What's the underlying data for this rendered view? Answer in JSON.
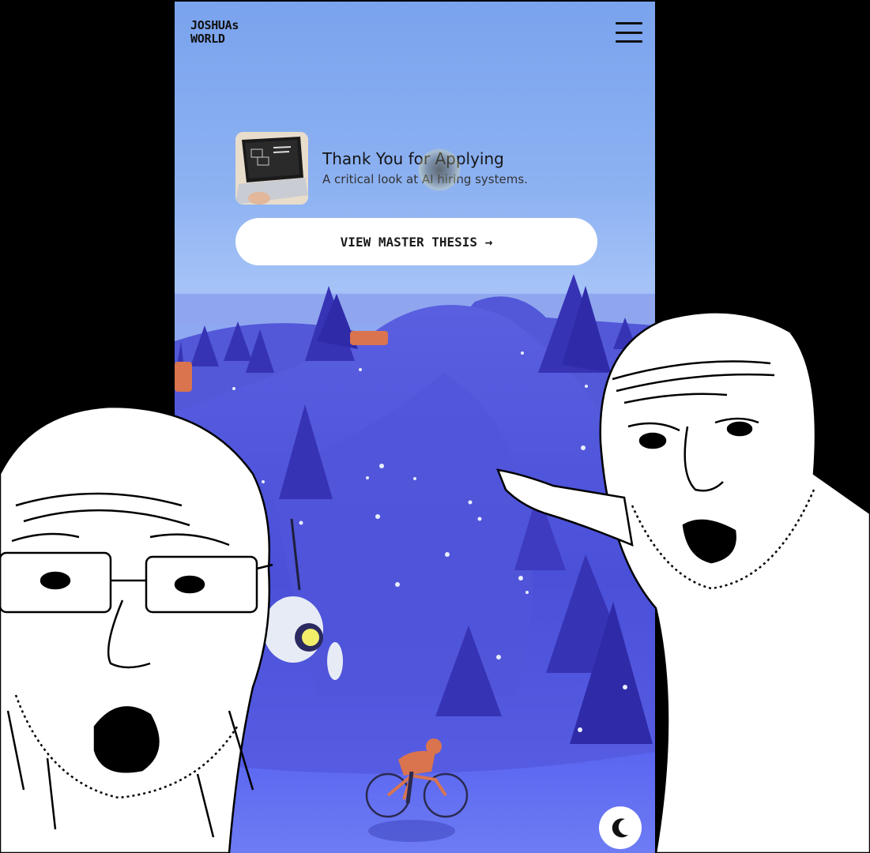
{
  "header": {
    "logo_line1": "JOSHUAs",
    "logo_line2": "WORLD",
    "menu_icon": "hamburger-menu-icon"
  },
  "feature": {
    "title": "Thank You for Applying",
    "subtitle": "A critical look at AI hiring systems.",
    "thumbnail_icon": "laptop-thumbnail"
  },
  "cta": {
    "label": "VIEW MASTER THESIS →"
  },
  "theme_toggle": {
    "icon": "moon-icon"
  },
  "colors": {
    "sky": "#8db2f2",
    "hill": "#4f56e0",
    "tree": "#3a36b8",
    "cyclist": "#d9744f"
  }
}
